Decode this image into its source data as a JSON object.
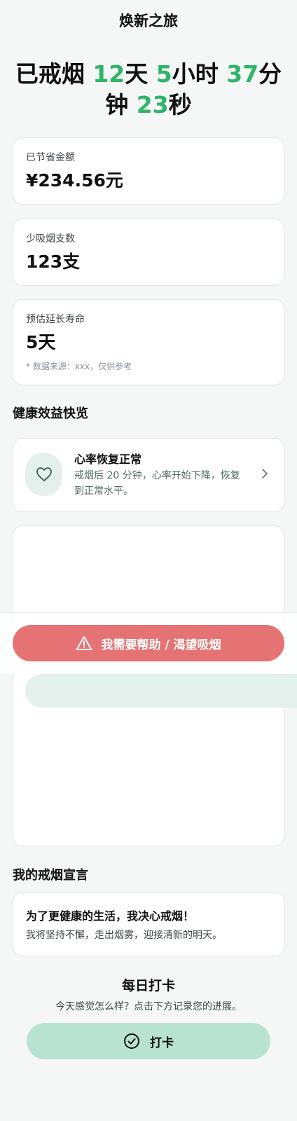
{
  "app": {
    "title": "焕新之旅"
  },
  "timer": {
    "prefix": "已戒烟",
    "days": "12",
    "days_unit": "天",
    "hours": "5",
    "hours_unit": "小时",
    "minutes": "37",
    "minutes_unit": "分钟",
    "seconds": "23",
    "seconds_unit": "秒"
  },
  "stats": {
    "money": {
      "label": "已节省金额",
      "value": "¥234.56元"
    },
    "cigarettes": {
      "label": "少吸烟支数",
      "value": "123支"
    },
    "lifespan": {
      "label": "预估延长寿命",
      "value": "5天",
      "note": "* 数据来源：xxx，仅供参考"
    }
  },
  "health": {
    "title": "健康效益快览",
    "benefit": {
      "icon": "heart-icon",
      "title": "心率恢复正常",
      "desc": "戒烟后 20 分钟，心率开始下降，恢复到正常水平。"
    }
  },
  "help_button": {
    "label": "我需要帮助 / 渴望吸烟",
    "icon": "warning-icon"
  },
  "pledge": {
    "section_title": "我的戒烟宣言",
    "title": "为了更健康的生活，我决心戒烟！",
    "text": "我将坚持不懈，走出烟雾，迎接清新的明天。"
  },
  "checkin": {
    "title": "每日打卡",
    "subtitle": "今天感觉怎么样？点击下方记录您的进展。",
    "button_label": "打卡",
    "icon": "check-circle-icon"
  },
  "colors": {
    "accent": "#2fb56a",
    "danger": "#e57373",
    "mint": "#b8e3d2",
    "mint_light": "#e4f0ec"
  }
}
